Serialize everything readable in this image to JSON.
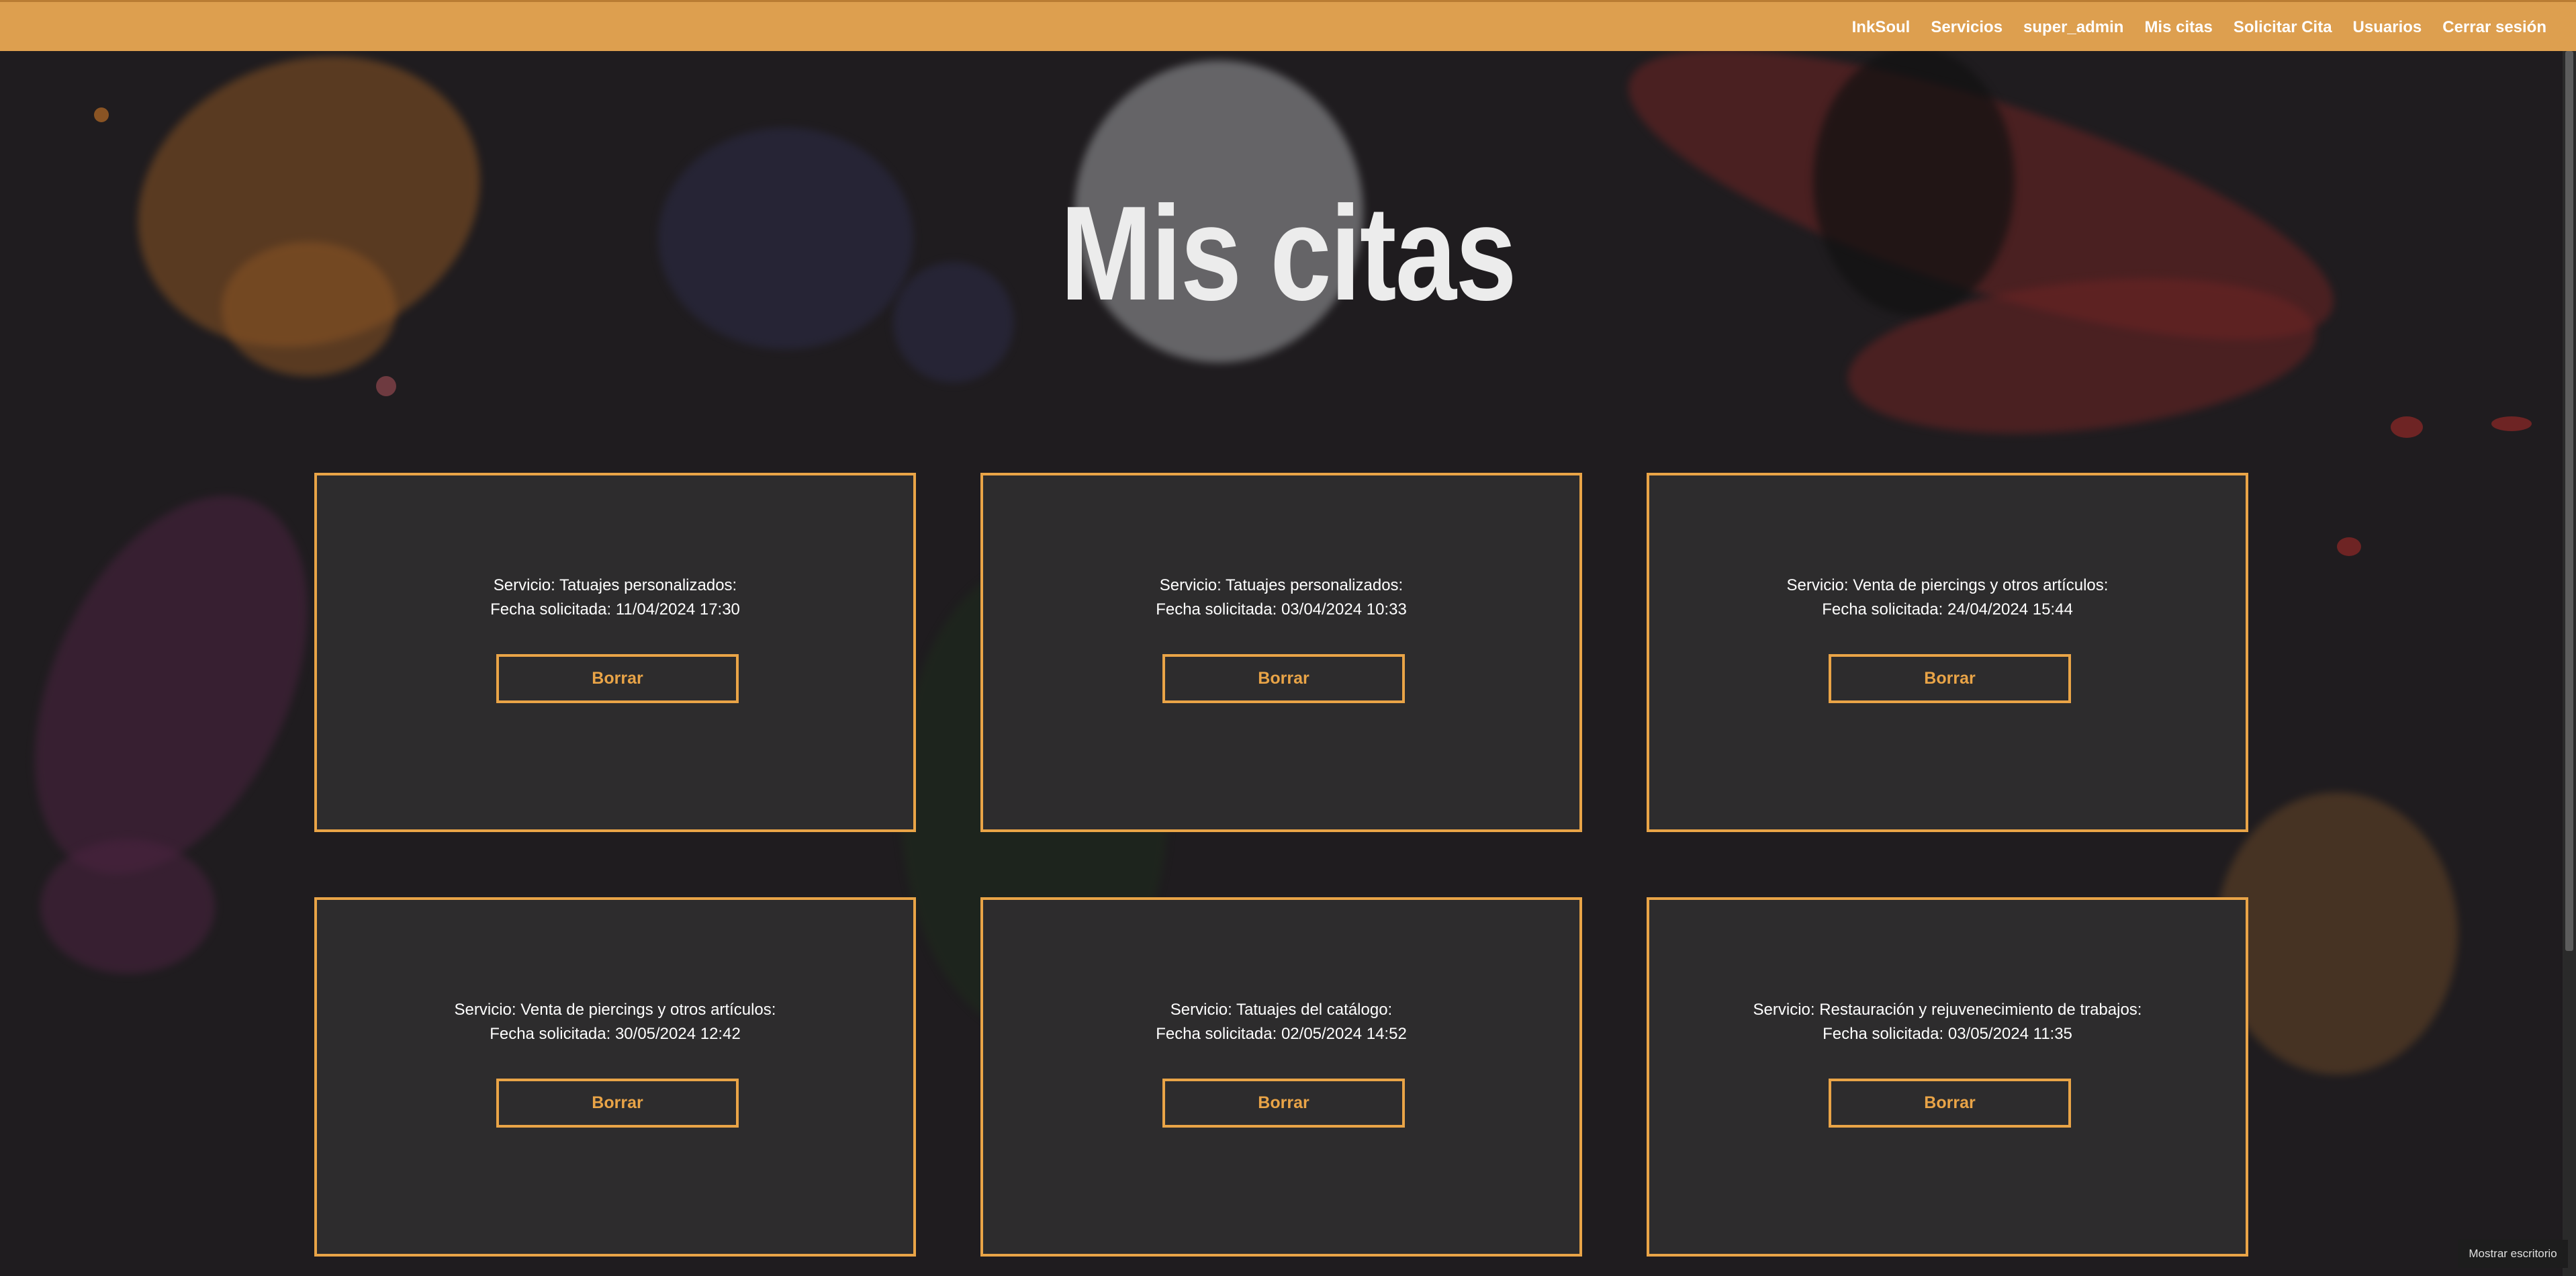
{
  "navbar": {
    "items": [
      "InkSoul",
      "Servicios",
      "super_admin",
      "Mis citas",
      "Solicitar Cita",
      "Usuarios",
      "Cerrar sesión"
    ]
  },
  "page": {
    "title": "Mis citas"
  },
  "appointments": [
    {
      "service": "Servicio: Tatuajes personalizados:",
      "date": "Fecha solicitada: 11/04/2024 17:30",
      "button": "Borrar"
    },
    {
      "service": "Servicio: Tatuajes personalizados:",
      "date": "Fecha solicitada: 03/04/2024 10:33",
      "button": "Borrar"
    },
    {
      "service": "Servicio: Venta de piercings y otros artículos:",
      "date": "Fecha solicitada: 24/04/2024 15:44",
      "button": "Borrar"
    },
    {
      "service": "Servicio: Venta de piercings y otros artículos:",
      "date": "Fecha solicitada: 30/05/2024 12:42",
      "button": "Borrar"
    },
    {
      "service": "Servicio: Tatuajes del catálogo:",
      "date": "Fecha solicitada: 02/05/2024 14:52",
      "button": "Borrar"
    },
    {
      "service": "Servicio: Restauración y rejuvenecimiento de trabajos:",
      "date": "Fecha solicitada: 03/05/2024 11:35",
      "button": "Borrar"
    }
  ],
  "taskbar": {
    "show_desktop": "Mostrar escritorio"
  },
  "colors": {
    "navbar_bg": "#dd9f4f",
    "accent": "#e9a447",
    "page_bg": "#1f1c1f",
    "card_bg": "#2d2c2d"
  }
}
